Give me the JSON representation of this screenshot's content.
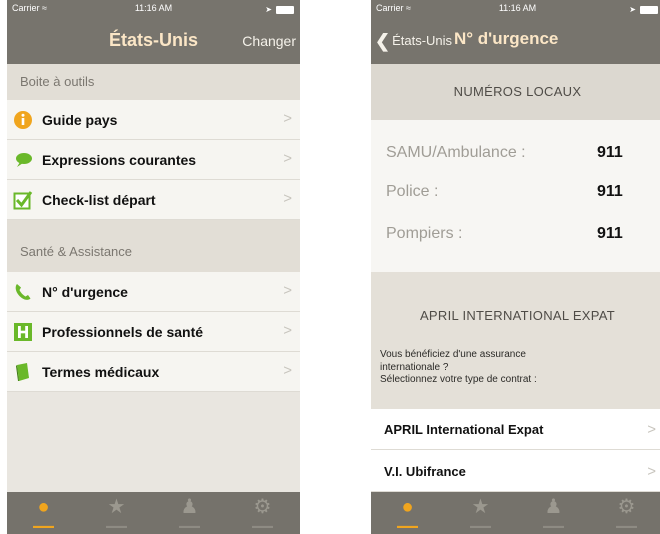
{
  "left": {
    "status": {
      "carrier": "Carrier ≈",
      "time": "11:16 AM"
    },
    "nav": {
      "title": "États-Unis",
      "right_button": "Changer"
    },
    "sections": [
      {
        "header": "Boite à outils",
        "items": [
          {
            "label": "Guide pays",
            "icon": "info-icon"
          },
          {
            "label": "Expressions courantes",
            "icon": "speech-bubble-icon"
          },
          {
            "label": "Check-list départ",
            "icon": "checkbox-icon"
          }
        ]
      },
      {
        "header": "Santé & Assistance",
        "items": [
          {
            "label": "N° d'urgence",
            "icon": "phone-icon"
          },
          {
            "label": "Professionnels de santé",
            "icon": "hospital-icon"
          },
          {
            "label": "Termes médicaux",
            "icon": "book-icon"
          }
        ]
      }
    ],
    "chevron": ">"
  },
  "right": {
    "status": {
      "carrier": "Carrier ≈",
      "time": "11:16 AM"
    },
    "nav": {
      "back_label": "États-Unis",
      "title": "N° d'urgence"
    },
    "local_header": "NUMÉROS LOCAUX",
    "numbers": [
      {
        "label": "SAMU/Ambulance :",
        "value": "911"
      },
      {
        "label": "Police :",
        "value": "911"
      },
      {
        "label": "Pompiers :",
        "value": "911"
      }
    ],
    "expat": {
      "title": "APRIL INTERNATIONAL EXPAT",
      "line1": "Vous bénéficiez d'une assurance",
      "line2": "internationale ?",
      "line3": "Sélectionnez votre type de contrat :"
    },
    "contracts": [
      {
        "label": "APRIL International Expat"
      },
      {
        "label": "V.I. Ubifrance"
      }
    ],
    "chevron": ">"
  },
  "tabs": [
    {
      "icon": "home-globe-icon",
      "active": true
    },
    {
      "icon": "star-icon",
      "active": false
    },
    {
      "icon": "person-icon",
      "active": false
    },
    {
      "icon": "gear-icon",
      "active": false
    }
  ],
  "colors": {
    "nav_bg": "#77746d",
    "accent": "#f0a51e",
    "title": "#fbe6c6"
  }
}
